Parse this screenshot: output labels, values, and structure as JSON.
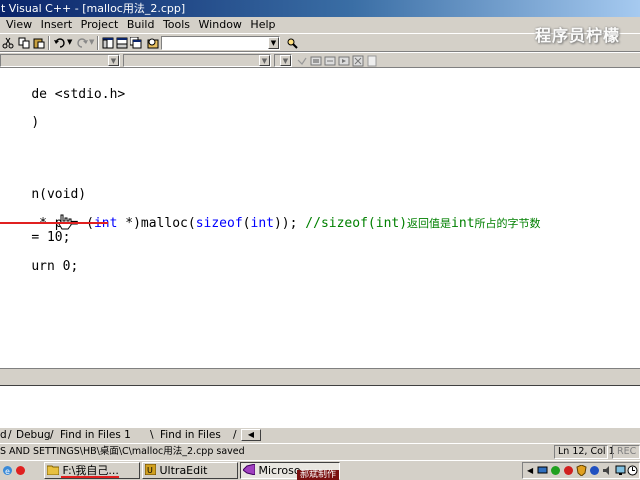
{
  "title_bar": {
    "text": "t Visual C++ - [malloc用法_2.cpp]"
  },
  "watermark": "程序员柠檬",
  "menu": [
    "View",
    "Insert",
    "Project",
    "Build",
    "Tools",
    "Window",
    "Help"
  ],
  "toolbar": {
    "find_combo_value": "",
    "icons": [
      "cut-icon",
      "copy-icon",
      "paste-icon",
      "undo-icon",
      "redo-icon",
      "workspace-icon",
      "output-icon",
      "window-list-icon",
      "find-in-files-icon",
      "search-icon"
    ]
  },
  "editor": {
    "lines": [
      {
        "parts": [
          {
            "t": "de <stdio.h>",
            "c": "normal"
          }
        ]
      },
      {
        "parts": [
          {
            "t": ")",
            "c": "normal"
          }
        ]
      },
      {
        "parts": [
          {
            "t": "n(void)",
            "c": "normal"
          }
        ]
      },
      {
        "parts": [
          {
            "t": " * p = (",
            "c": "normal"
          },
          {
            "t": "int",
            "c": "kw"
          },
          {
            "t": " *)malloc(",
            "c": "normal"
          },
          {
            "t": "sizeof",
            "c": "kw"
          },
          {
            "t": "(",
            "c": "normal"
          },
          {
            "t": "int",
            "c": "kw"
          },
          {
            "t": ")); ",
            "c": "normal"
          },
          {
            "t": "//sizeof(int)",
            "c": "cm"
          },
          {
            "t": "返回值是",
            "c": "cmcjk"
          },
          {
            "t": "int",
            "c": "cm"
          },
          {
            "t": "所占的字节数",
            "c": "cmcjk"
          }
        ]
      },
      {
        "parts": [
          {
            "t": "= 10;",
            "c": "normal"
          }
        ]
      },
      {
        "parts": [
          {
            "t": "urn 0;",
            "c": "normal"
          }
        ]
      }
    ]
  },
  "output_tabs": [
    "d",
    "Debug",
    "Find in Files 1",
    "Find in Files"
  ],
  "status": {
    "message": "S AND SETTINGS\\HB\\桌面\\C\\malloc用法_2.cpp saved",
    "position": "Ln 12, Col 1",
    "rec": "REC"
  },
  "taskbar": {
    "tasks": [
      {
        "label": "F:\\我自己...",
        "active": false
      },
      {
        "label": "UltraEdit",
        "active": false
      },
      {
        "label": "Microso...",
        "active": true
      }
    ],
    "credit": "郝斌制作"
  },
  "colors": {
    "keyword": "#0000ff",
    "comment": "#008000",
    "title_bar": "#0a246a",
    "chrome": "#d4d0c8"
  }
}
